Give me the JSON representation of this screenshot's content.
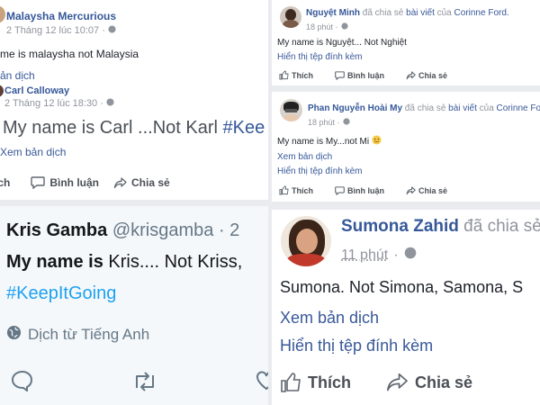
{
  "colors": {
    "fb_link": "#385898",
    "fb_name": "#365899",
    "twitter_blue": "#1da1f2",
    "divider": "#e9ebee"
  },
  "icons": [
    "globe-icon",
    "comment-icon",
    "share-icon",
    "like-icon",
    "retweet-icon",
    "reply-icon",
    "heart-icon"
  ],
  "topleft": {
    "author": "Malaysha Mercurious",
    "time": "2 Tháng 12 lúc 10:07 ·",
    "text": "me is malaysha not Malaysia",
    "translate": "ản dịch",
    "reply": {
      "author": "Carl Calloway",
      "time": "2 Tháng 12 lúc 18:30 ·",
      "text": "My name is Carl ...Not Karl",
      "hashtag": "#Kee",
      "translate": "Xem bản dịch"
    },
    "actions": {
      "share_partial": "ích",
      "comment": "Bình luận",
      "share": "Chia sẻ"
    }
  },
  "twitter": {
    "name": "Kris Gamba",
    "handle": "@krisgamba",
    "dot": "· 2",
    "text_bold": "My name is",
    "text_rest": " Kris.... Not Kriss,",
    "hashtag": "#KeepItGoing",
    "translate": "Dịch từ Tiếng Anh"
  },
  "post1": {
    "author": "Nguyệt Minh",
    "action": " đã chia sẻ ",
    "link": "bài viết",
    "of": " của ",
    "owner": "Corinne Ford.",
    "time": "18 phút ·",
    "text": "My name is Nguyệt... Not Nghiệt",
    "attachment": "Hiển thị tệp đính kèm",
    "actions": {
      "like": "Thích",
      "comment": "Bình luận",
      "share": "Chia sẻ"
    }
  },
  "post2": {
    "author": "Phan Nguyễn Hoài My",
    "action": " đã chia sẻ ",
    "link": "bài viết",
    "of": " của ",
    "owner": "Corinne Fo",
    "time": "18 phút ·",
    "text": "My name is My...not Mi",
    "translate": "Xem bản dịch",
    "attachment": "Hiển thị tệp đính kèm",
    "actions": {
      "like": "Thích",
      "comment": "Bình luận",
      "share": "Chia sẻ"
    }
  },
  "post3": {
    "author": "Sumona Zahid",
    "action": " đã chia sẻ",
    "time": "11 phút",
    "text": "Sumona. Not Simona, Samona, S",
    "translate": "Xem bản dịch",
    "attachment": "Hiển thị tệp đính kèm",
    "actions": {
      "like": "Thích",
      "share": "Chia sẻ"
    }
  }
}
